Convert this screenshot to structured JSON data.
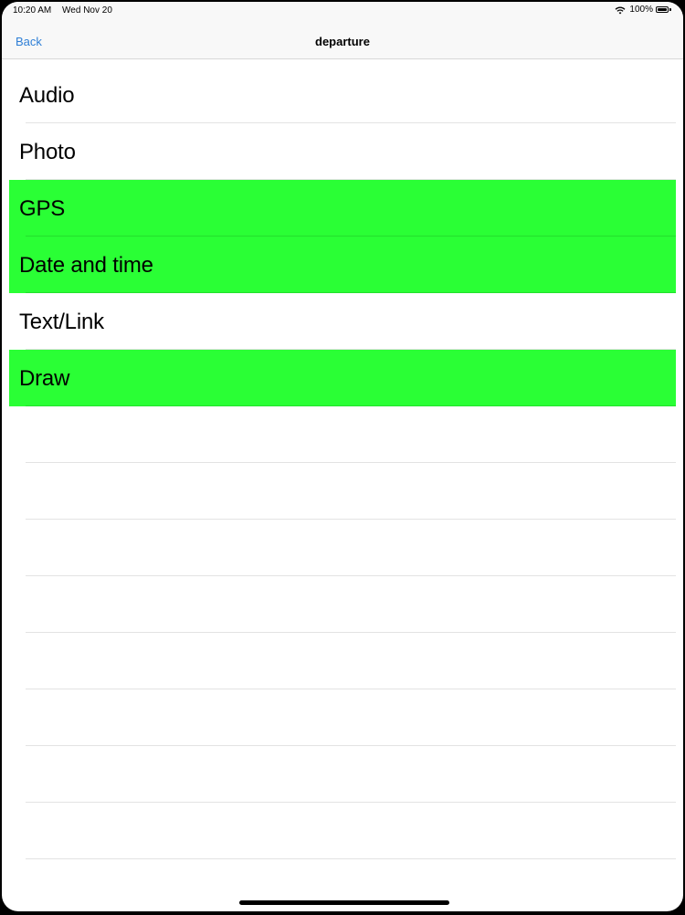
{
  "status_bar": {
    "time": "10:20 AM",
    "date": "Wed Nov 20",
    "battery": "100%",
    "wifi_icon": "wifi-icon",
    "battery_icon": "battery-icon"
  },
  "nav": {
    "back_label": "Back",
    "title": "departure"
  },
  "list": {
    "items": [
      {
        "label": "Audio",
        "highlighted": false
      },
      {
        "label": "Photo",
        "highlighted": false
      },
      {
        "label": "GPS",
        "highlighted": true
      },
      {
        "label": "Date and time",
        "highlighted": true
      },
      {
        "label": "Text/Link",
        "highlighted": false
      },
      {
        "label": "Draw",
        "highlighted": true
      }
    ]
  },
  "colors": {
    "highlight": "#2aff35",
    "link": "#2f7fd6",
    "bar_background": "#f8f8f8"
  }
}
